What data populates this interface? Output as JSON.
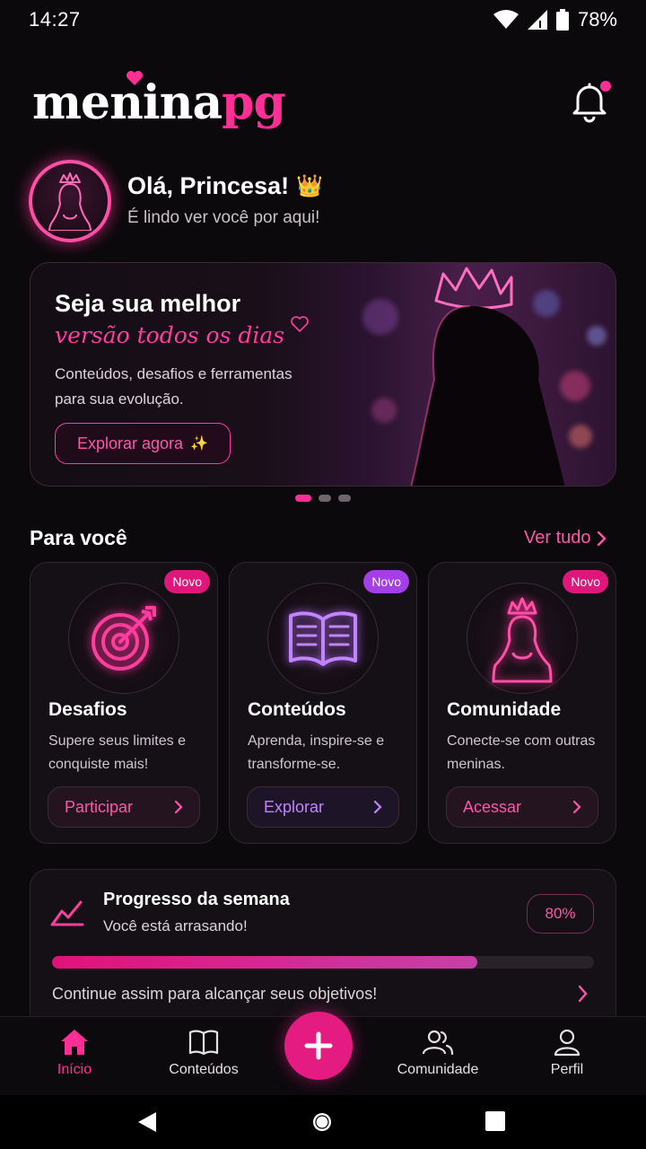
{
  "status_bar": {
    "time": "14:27",
    "battery": "78%"
  },
  "header": {
    "logo_part1": "menina",
    "logo_part2": "pg"
  },
  "greeting": {
    "title": "Olá, Princesa!",
    "emoji": "👑",
    "subtitle": "É lindo ver você por aqui!"
  },
  "banner": {
    "title": "Seja sua melhor",
    "script": "versão todos os dias",
    "description": "Conteúdos, desafios e ferramentas para sua evolução.",
    "button": "Explorar agora",
    "button_emoji": "✨",
    "slides": 3,
    "active_slide": 1
  },
  "section": {
    "title": "Para você",
    "see_all": "Ver tudo"
  },
  "cards": [
    {
      "badge": "Novo",
      "title": "Desafios",
      "description": "Supere seus limites e conquiste mais!",
      "button": "Participar",
      "accent": "#ff2f96",
      "badge_color": "#e0177a",
      "icon": "target-icon"
    },
    {
      "badge": "Novo",
      "title": "Conteúdos",
      "description": "Aprenda, inspire-se e transforme-se.",
      "button": "Explorar",
      "accent": "#b56cff",
      "badge_color": "#a43ee6",
      "icon": "book-icon"
    },
    {
      "badge": "Novo",
      "title": "Comunidade",
      "description": "Conecte-se com outras meninas.",
      "button": "Acessar",
      "accent": "#ff2f96",
      "badge_color": "#e0177a",
      "icon": "princess-icon"
    }
  ],
  "progress": {
    "title": "Progresso da semana",
    "subtitle": "Você está arrasando!",
    "percent_label": "80%",
    "value": 0.785,
    "footer": "Continue assim para alcançar seus objetivos!"
  },
  "bottom_nav": {
    "items": [
      {
        "label": "Início",
        "icon": "home-icon",
        "active": true
      },
      {
        "label": "Conteúdos",
        "icon": "book-icon",
        "active": false
      },
      {
        "label": "Comunidade",
        "icon": "users-icon",
        "active": false
      },
      {
        "label": "Perfil",
        "icon": "user-icon",
        "active": false
      }
    ]
  },
  "colors": {
    "accent": "#ff2f96",
    "background": "#0b090c",
    "card": "#141015"
  }
}
